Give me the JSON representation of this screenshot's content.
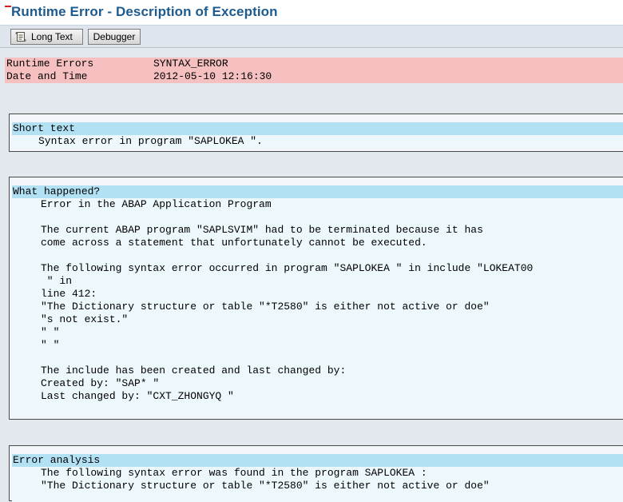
{
  "window": {
    "title": "Runtime Error - Description of Exception"
  },
  "toolbar": {
    "long_text_label": "Long Text",
    "debugger_label": "Debugger",
    "long_text_icon": "scroll-icon"
  },
  "header": {
    "runtime_errors_label": "Runtime Errors",
    "runtime_errors_value": "SYNTAX_ERROR",
    "date_time_label": "Date and Time",
    "date_time_value": "2012-05-10 12:16:30"
  },
  "sections": {
    "short_text": {
      "heading": "Short text",
      "lines": [
        "Syntax error in program \"SAPLOKEA \"."
      ]
    },
    "what_happened": {
      "heading": "What happened?",
      "lines": [
        "Error in the ABAP Application Program",
        "",
        "The current ABAP program \"SAPLSVIM\" had to be terminated because it has",
        "come across a statement that unfortunately cannot be executed.",
        "",
        "The following syntax error occurred in program \"SAPLOKEA \" in include \"LOKEAT00",
        " \" in",
        "line 412:",
        "\"The Dictionary structure or table \"*T2580\" is either not active or doe\"",
        "\"s not exist.\"",
        "\" \"",
        "\" \"",
        "",
        "",
        "The include has been created and last changed by:",
        "Created by: \"SAP* \"",
        "Last changed by: \"CXT_ZHONGYQ \""
      ]
    },
    "error_analysis": {
      "heading": "Error analysis",
      "lines": [
        "The following syntax error was found in the program SAPLOKEA :",
        "\"The Dictionary structure or table \"*T2580\" is either not active or doe\""
      ]
    }
  },
  "colors": {
    "title": "#1d5b8e",
    "header_row_bg": "#f7c0c0",
    "section_heading_bg": "#b2e1f4",
    "section_body_bg": "#edf8fc",
    "page_bg": "#e3e8ef"
  }
}
